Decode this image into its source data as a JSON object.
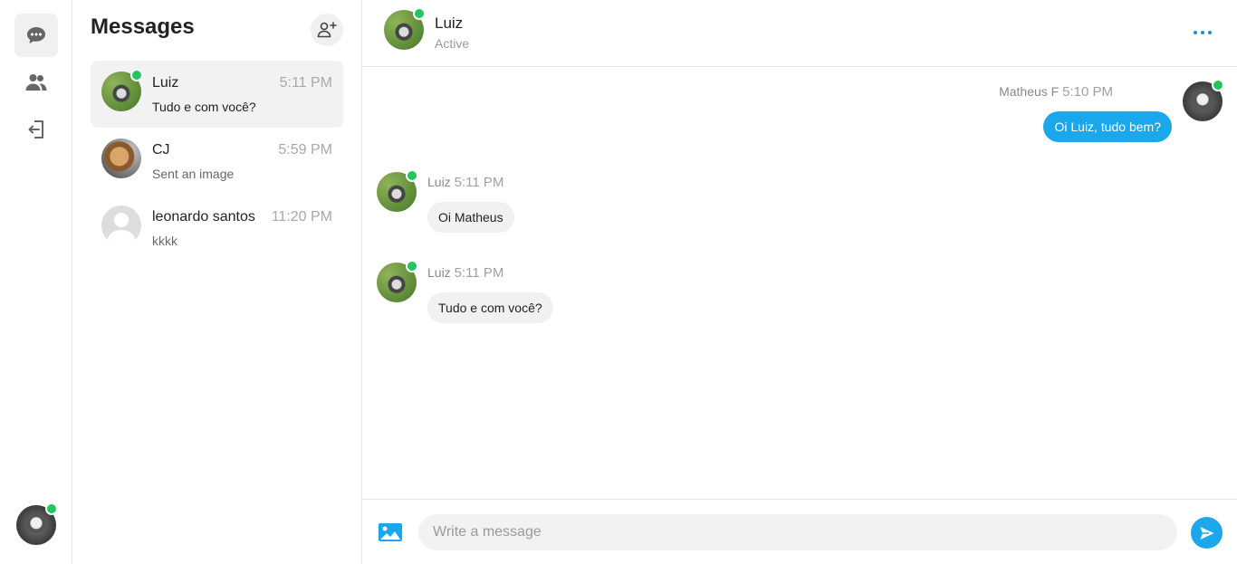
{
  "colors": {
    "accent": "#1aa7ec",
    "online": "#22c55e",
    "muted": "#a8a8a8"
  },
  "rail": {
    "items": [
      {
        "icon": "chat-bubble-icon",
        "active": true
      },
      {
        "icon": "people-icon",
        "active": false
      },
      {
        "icon": "logout-icon",
        "active": false
      }
    ],
    "current_user_avatar": "husky-avatar",
    "current_user_online": true
  },
  "list": {
    "title": "Messages",
    "add_friend_icon": "add-friend-icon",
    "conversations": [
      {
        "name": "Luiz",
        "time": "5:11 PM",
        "preview": "Tudo e com você?",
        "online": true,
        "active": true
      },
      {
        "name": "CJ",
        "time": "5:59 PM",
        "preview": "Sent an image",
        "online": false,
        "active": false
      },
      {
        "name": "leonardo santos",
        "time": "11:20 PM",
        "preview": "kkkk",
        "online": false,
        "active": false
      }
    ]
  },
  "chat": {
    "header": {
      "name": "Luiz",
      "status": "Active",
      "online": true,
      "more_icon": "more-dots-icon"
    },
    "messages": [
      {
        "direction": "outgoing",
        "sender": "Matheus F",
        "time": "5:10 PM",
        "text": "Oi Luiz, tudo bem?"
      },
      {
        "direction": "incoming",
        "sender": "Luiz",
        "time": "5:11 PM",
        "text": "Oi Matheus"
      },
      {
        "direction": "incoming",
        "sender": "Luiz",
        "time": "5:11 PM",
        "text": "Tudo e com você?"
      }
    ],
    "composer": {
      "placeholder": "Write a message",
      "value": "",
      "image_icon": "image-icon",
      "send_icon": "send-icon"
    }
  }
}
